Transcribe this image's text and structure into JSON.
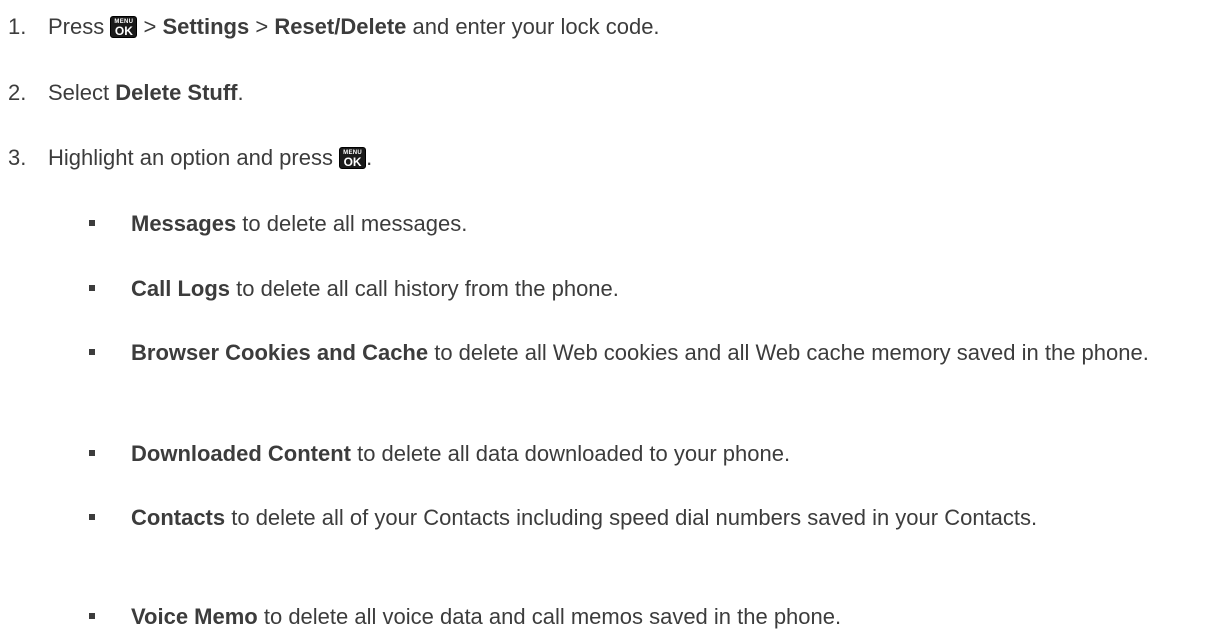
{
  "steps": [
    {
      "number": "1.",
      "pre": "Press ",
      "key_top": "MENU",
      "key_bottom": "OK",
      "sep1": " > ",
      "bold1": "Settings",
      "sep2": " > ",
      "bold2": "Reset/Delete",
      "post": " and enter your lock code."
    },
    {
      "number": "2.",
      "pre": "Select ",
      "bold1": "Delete Stuff",
      "post": "."
    },
    {
      "number": "3.",
      "pre": "Highlight an option and press ",
      "key_top": "MENU",
      "key_bottom": "OK",
      "post": "."
    }
  ],
  "options": [
    {
      "bold": "Messages",
      "text": " to delete all messages."
    },
    {
      "bold": "Call Logs",
      "text": " to delete all call history from the phone."
    },
    {
      "bold": "Browser Cookies and Cache",
      "text": " to delete all Web cookies and all Web cache memory saved in the phone."
    },
    {
      "bold": "Downloaded Content",
      "text": " to delete all data downloaded to your phone."
    },
    {
      "bold": "Contacts",
      "text": " to delete all of your Contacts including speed dial numbers saved in your Contacts."
    },
    {
      "bold": "Voice Memo",
      "text": " to delete all voice data and call memos saved in the phone."
    }
  ],
  "colors": {
    "text": "#3c3c3c",
    "key_background": "#1a1a1a"
  },
  "icons": {
    "menu_ok_key": "menu-ok-key-icon",
    "bullet": "square-bullet-icon"
  }
}
